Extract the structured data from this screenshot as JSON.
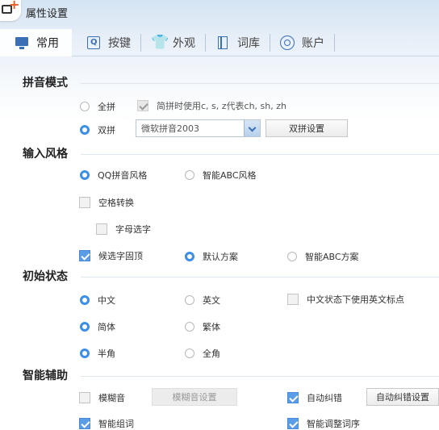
{
  "window": {
    "title": "属性设置"
  },
  "tabs": [
    {
      "label": "常用",
      "icon": "monitor-icon",
      "active": true
    },
    {
      "label": "按键",
      "icon": "keyboard-icon",
      "active": false
    },
    {
      "label": "外观",
      "icon": "shirt-icon",
      "active": false
    },
    {
      "label": "词库",
      "icon": "book-icon",
      "active": false
    },
    {
      "label": "账户",
      "icon": "account-icon",
      "active": false
    }
  ],
  "sections": {
    "pinyin_mode": {
      "title": "拼音模式",
      "full_pinyin": "全拼",
      "shuangpin": "双拼",
      "jianpin_option": "简拼时使用c, s, z代表ch, sh, zh",
      "scheme_select": "微软拼音2003",
      "shuangpin_settings": "双拼设置"
    },
    "input_style": {
      "title": "输入风格",
      "qq_style": "QQ拼音风格",
      "abc_style": "智能ABC风格",
      "space_convert": "空格转换",
      "letter_select": "字母选字",
      "candidate_fix": "候选字固顶",
      "default_scheme": "默认方案",
      "abc_scheme": "智能ABC方案"
    },
    "initial_state": {
      "title": "初始状态",
      "chinese": "中文",
      "english": "英文",
      "english_punct": "中文状态下使用英文标点",
      "simplified": "简体",
      "traditional": "繁体",
      "half_width": "半角",
      "full_width": "全角"
    },
    "smart_assist": {
      "title": "智能辅助",
      "fuzzy": "模糊音",
      "fuzzy_settings": "模糊音设置",
      "auto_correct": "自动纠错",
      "auto_correct_settings": "自动纠错设置",
      "smart_phrase": "智能组词",
      "smart_adjust": "智能调整词序"
    }
  },
  "colors": {
    "accent": "#3b8fe6",
    "icon": "#3a6fb5"
  }
}
